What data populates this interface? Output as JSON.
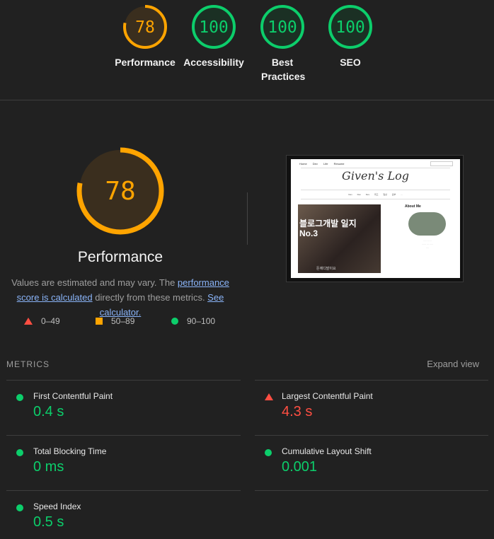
{
  "summary_gauges": [
    {
      "score": "78",
      "fraction": 0.78,
      "label": "Performance",
      "color": "#ffa400",
      "bg": "#3a2e1e"
    },
    {
      "score": "100",
      "fraction": 1.0,
      "label": "Accessibility",
      "color": "#0cce6b",
      "bg": "#1b3024"
    },
    {
      "score": "100",
      "fraction": 1.0,
      "label": "Best Practices",
      "color": "#0cce6b",
      "bg": "#1b3024"
    },
    {
      "score": "100",
      "fraction": 1.0,
      "label": "SEO",
      "color": "#0cce6b",
      "bg": "#1b3024"
    }
  ],
  "performance": {
    "score": "78",
    "fraction": 0.78,
    "title": "Performance",
    "note_prefix": "Values are estimated and may vary. The ",
    "note_link1": "performance score is calculated",
    "note_middle": " directly from these metrics. ",
    "note_link2": "See calculator."
  },
  "legend": [
    {
      "shape": "triangle",
      "range": "0–49",
      "color": "#ff4e42"
    },
    {
      "shape": "square",
      "range": "50–89",
      "color": "#ffa400"
    },
    {
      "shape": "circle",
      "range": "90–100",
      "color": "#0cce6b"
    }
  ],
  "screenshot": {
    "nav": [
      "Home",
      "Dev",
      "Life",
      "Resume"
    ],
    "logo": "Given's Log",
    "menu": [
      "Dev",
      "Dev",
      "Dev",
      "회고",
      "일상",
      "공부",
      "..."
    ],
    "hero_title": "블로그개발 일지\nNo.3",
    "hero_caption": "돈에디발이요",
    "about_title": "About Me"
  },
  "metrics": {
    "heading": "METRICS",
    "expand_label": "Expand view",
    "items": [
      {
        "name": "First Contentful Paint",
        "value": "0.4 s",
        "status": "good"
      },
      {
        "name": "Largest Contentful Paint",
        "value": "4.3 s",
        "status": "poor"
      },
      {
        "name": "Total Blocking Time",
        "value": "0 ms",
        "status": "good"
      },
      {
        "name": "Cumulative Layout Shift",
        "value": "0.001",
        "status": "good"
      },
      {
        "name": "Speed Index",
        "value": "0.5 s",
        "status": "good"
      }
    ]
  }
}
